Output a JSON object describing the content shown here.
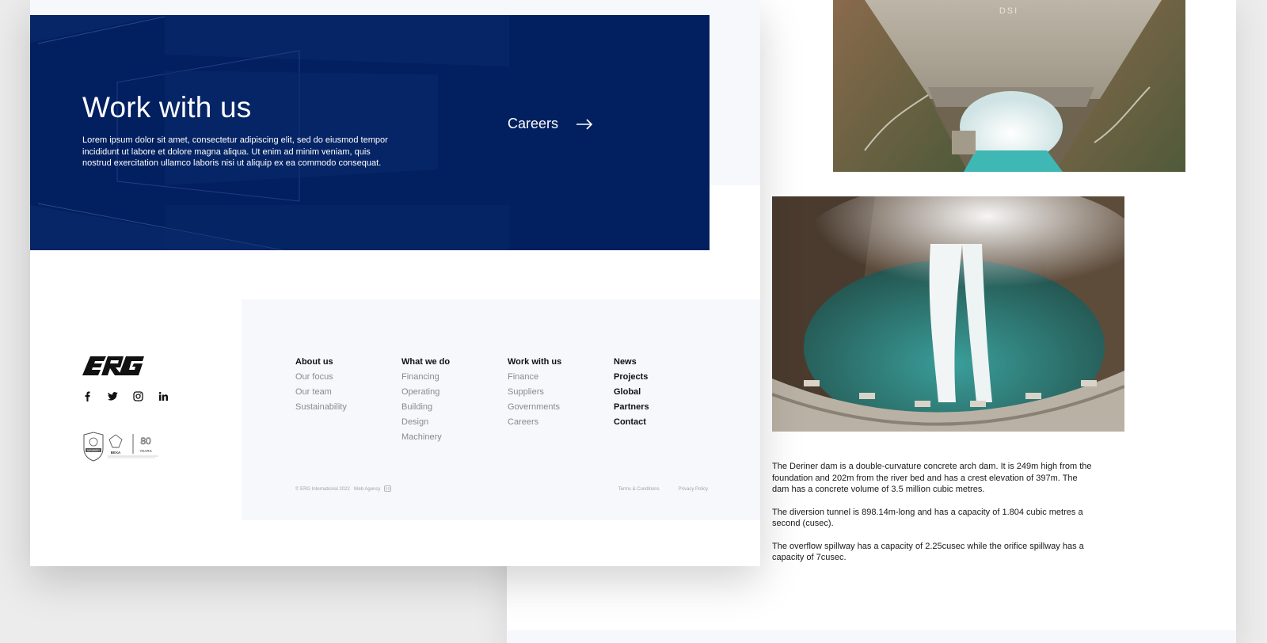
{
  "banner": {
    "title": "Work with us",
    "body": "Lorem ipsum dolor sit amet, consectetur adipiscing elit, sed do eiusmod tempor incididunt ut labore et dolore magna aliqua. Ut enim ad minim veniam, quis nostrud exercitation ullamco laboris nisi ut aliquip ex ea commodo consequat.",
    "cta_label": "Careers",
    "cta_icon": "arrow-right-icon",
    "background": "#022060"
  },
  "footer": {
    "logo_text": "ERG",
    "social": [
      {
        "name": "facebook-icon"
      },
      {
        "name": "twitter-icon"
      },
      {
        "name": "instagram-icon"
      },
      {
        "name": "linkedin-icon"
      }
    ],
    "badges": {
      "member_label": "MEMBER",
      "bexa_label": "BEXA",
      "years_number": "80",
      "years_label": "YEARS"
    },
    "columns": [
      {
        "heading": "About us",
        "items": [
          "Our focus",
          "Our team",
          "Sustainability"
        ]
      },
      {
        "heading": "What we do",
        "items": [
          "Financing",
          "Operating",
          "Building",
          "Design",
          "Machinery"
        ]
      },
      {
        "heading": "Work with us",
        "items": [
          "Finance",
          "Suppliers",
          "Governments",
          "Careers"
        ]
      },
      {
        "heading": "News",
        "items": [
          "Projects",
          "Global",
          "Partners",
          "Contact"
        ]
      }
    ],
    "copyright": "© ERG International 2022",
    "agency": "Web Agency",
    "terms": "Terms & Conditions",
    "privacy": "Privacy Policy"
  },
  "article": {
    "dam_sign": "DSI",
    "paragraphs": [
      "The Deriner dam is a double-curvature concrete arch dam. It is 249m high from the foundation and 202m from the river bed and has a crest elevation of 397m. The dam has a concrete volume of 3.5 million cubic metres.",
      "The diversion tunnel is 898.14m-long and has a capacity of 1.804 cubic metres a second (cusec).",
      "The overflow spillway has a capacity of 2.25cusec while the orifice spillway has a capacity of 7cusec."
    ]
  }
}
